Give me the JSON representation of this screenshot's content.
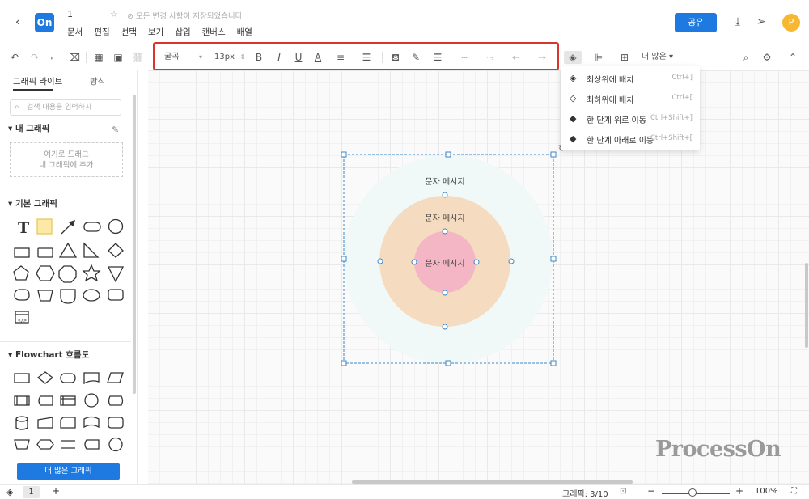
{
  "header": {
    "back_icon": "chevron-left-icon",
    "logo": "On",
    "doc_title": "1",
    "saved_status": "모든 변경 사항이 저장되었습니다",
    "menu": [
      "문서",
      "편집",
      "선택",
      "보기",
      "삽입",
      "캔버스",
      "배열"
    ],
    "share_label": "공유",
    "avatar_letter": "P"
  },
  "toolbar": {
    "font_family": "굴곡",
    "font_size": "13px",
    "more_label": "더 많은"
  },
  "sidebar": {
    "tabs": [
      "그래픽 라이브",
      "방식"
    ],
    "search_placeholder": "검색 내용을 입력하시",
    "my_graphics_title": "내 그래픽",
    "drop_line1": "여기로 드래그",
    "drop_line2": "내 그래픽에 추가",
    "basic_title": "기본 그래픽",
    "flowchart_title": "Flowchart 흐름도",
    "more_button": "더 많은 그래픽"
  },
  "diagram": {
    "outer_text": "문자 메시지",
    "middle_text": "문자 메시지",
    "inner_text": "문자 메시지",
    "colors": {
      "outer": "#f0f8f8",
      "middle": "#f5dcc0",
      "inner": "#f4b6c4"
    }
  },
  "dropdown": {
    "items": [
      {
        "label": "최상위에 배치",
        "shortcut": "Ctrl+]"
      },
      {
        "label": "최하위에 배치",
        "shortcut": "Ctrl+["
      },
      {
        "label": "한 단계 위로 이동",
        "shortcut": "Ctrl+Shift+]"
      },
      {
        "label": "한 단계 아래로 이동",
        "shortcut": "Ctrl+Shift+["
      }
    ]
  },
  "status": {
    "page": "1",
    "shape_count": "그래픽: 3/10",
    "zoom": "100%"
  },
  "watermark": "ProcessOn",
  "accent_color": "#1e7ae0",
  "highlight_color": "#d9342b"
}
